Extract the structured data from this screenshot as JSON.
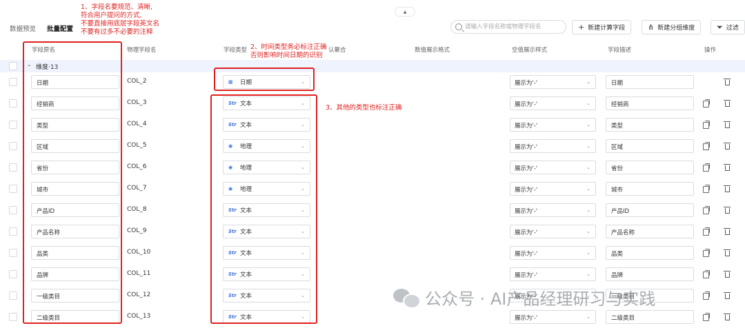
{
  "tabs": [
    {
      "label": "数据预览"
    },
    {
      "label": "批量配置"
    }
  ],
  "search": {
    "placeholder": "请输入字段名称或物理字段名"
  },
  "buttons": {
    "new_calc_field": "新建计算字段",
    "new_group_dim": "新建分组维度",
    "filter": "过滤"
  },
  "table": {
    "headers": {
      "field_name": "字段原名",
      "physical": "物理字段名",
      "type": "字段类型",
      "aggregate": "认聚合",
      "num_format": "数值展示格式",
      "null_style": "空值展示样式",
      "desc": "字段描述",
      "ops": "操作"
    },
    "group_label": "维度·13",
    "rows": [
      {
        "name": "日期",
        "physical": "COL_2",
        "type": "日期",
        "type_icon": "calendar-icon",
        "null": "展示为'-'",
        "desc": "日期"
      },
      {
        "name": "经销商",
        "physical": "COL_3",
        "type": "文本",
        "type_icon": "Str",
        "null": "展示为'-'",
        "desc": "经销商"
      },
      {
        "name": "类型",
        "physical": "COL_4",
        "type": "文本",
        "type_icon": "Str",
        "null": "展示为'-'",
        "desc": "类型"
      },
      {
        "name": "区域",
        "physical": "COL_5",
        "type": "地理",
        "type_icon": "location-icon",
        "null": "展示为'-'",
        "desc": "区域"
      },
      {
        "name": "省份",
        "physical": "COL_6",
        "type": "地理",
        "type_icon": "location-icon",
        "null": "展示为'-'",
        "desc": "省份"
      },
      {
        "name": "城市",
        "physical": "COL_7",
        "type": "地理",
        "type_icon": "location-icon",
        "null": "展示为'-'",
        "desc": "城市"
      },
      {
        "name": "产品ID",
        "physical": "COL_8",
        "type": "文本",
        "type_icon": "Str",
        "null": "展示为'-'",
        "desc": "产品ID"
      },
      {
        "name": "产品名称",
        "physical": "COL_9",
        "type": "文本",
        "type_icon": "Str",
        "null": "展示为'-'",
        "desc": "产品名称"
      },
      {
        "name": "品类",
        "physical": "COL_10",
        "type": "文本",
        "type_icon": "Str",
        "null": "展示为'-'",
        "desc": "品类"
      },
      {
        "name": "品牌",
        "physical": "COL_11",
        "type": "文本",
        "type_icon": "Str",
        "null": "展示为'-'",
        "desc": "品牌"
      },
      {
        "name": "一级类目",
        "physical": "COL_12",
        "type": "文本",
        "type_icon": "Str",
        "null": "展示为'-'",
        "desc": "一级类目"
      },
      {
        "name": "二级类目",
        "physical": "COL_13",
        "type": "文本",
        "type_icon": "Str",
        "null": "展示为'-'",
        "desc": "二级类目"
      }
    ]
  },
  "annotations": {
    "a1": [
      "1、字段名要规范、清晰,",
      "符合用户提问的方式,",
      "不要直接用底层字段英文名",
      "不要有过多不必要的注释"
    ],
    "a2": [
      "2、时间类型务必标注正确",
      "否则影响时间日期的识别"
    ],
    "a3": "3、其他的类型也标注正确",
    "color": "#e02020"
  },
  "watermark": "公众号 · AI产品经理研习与实践"
}
